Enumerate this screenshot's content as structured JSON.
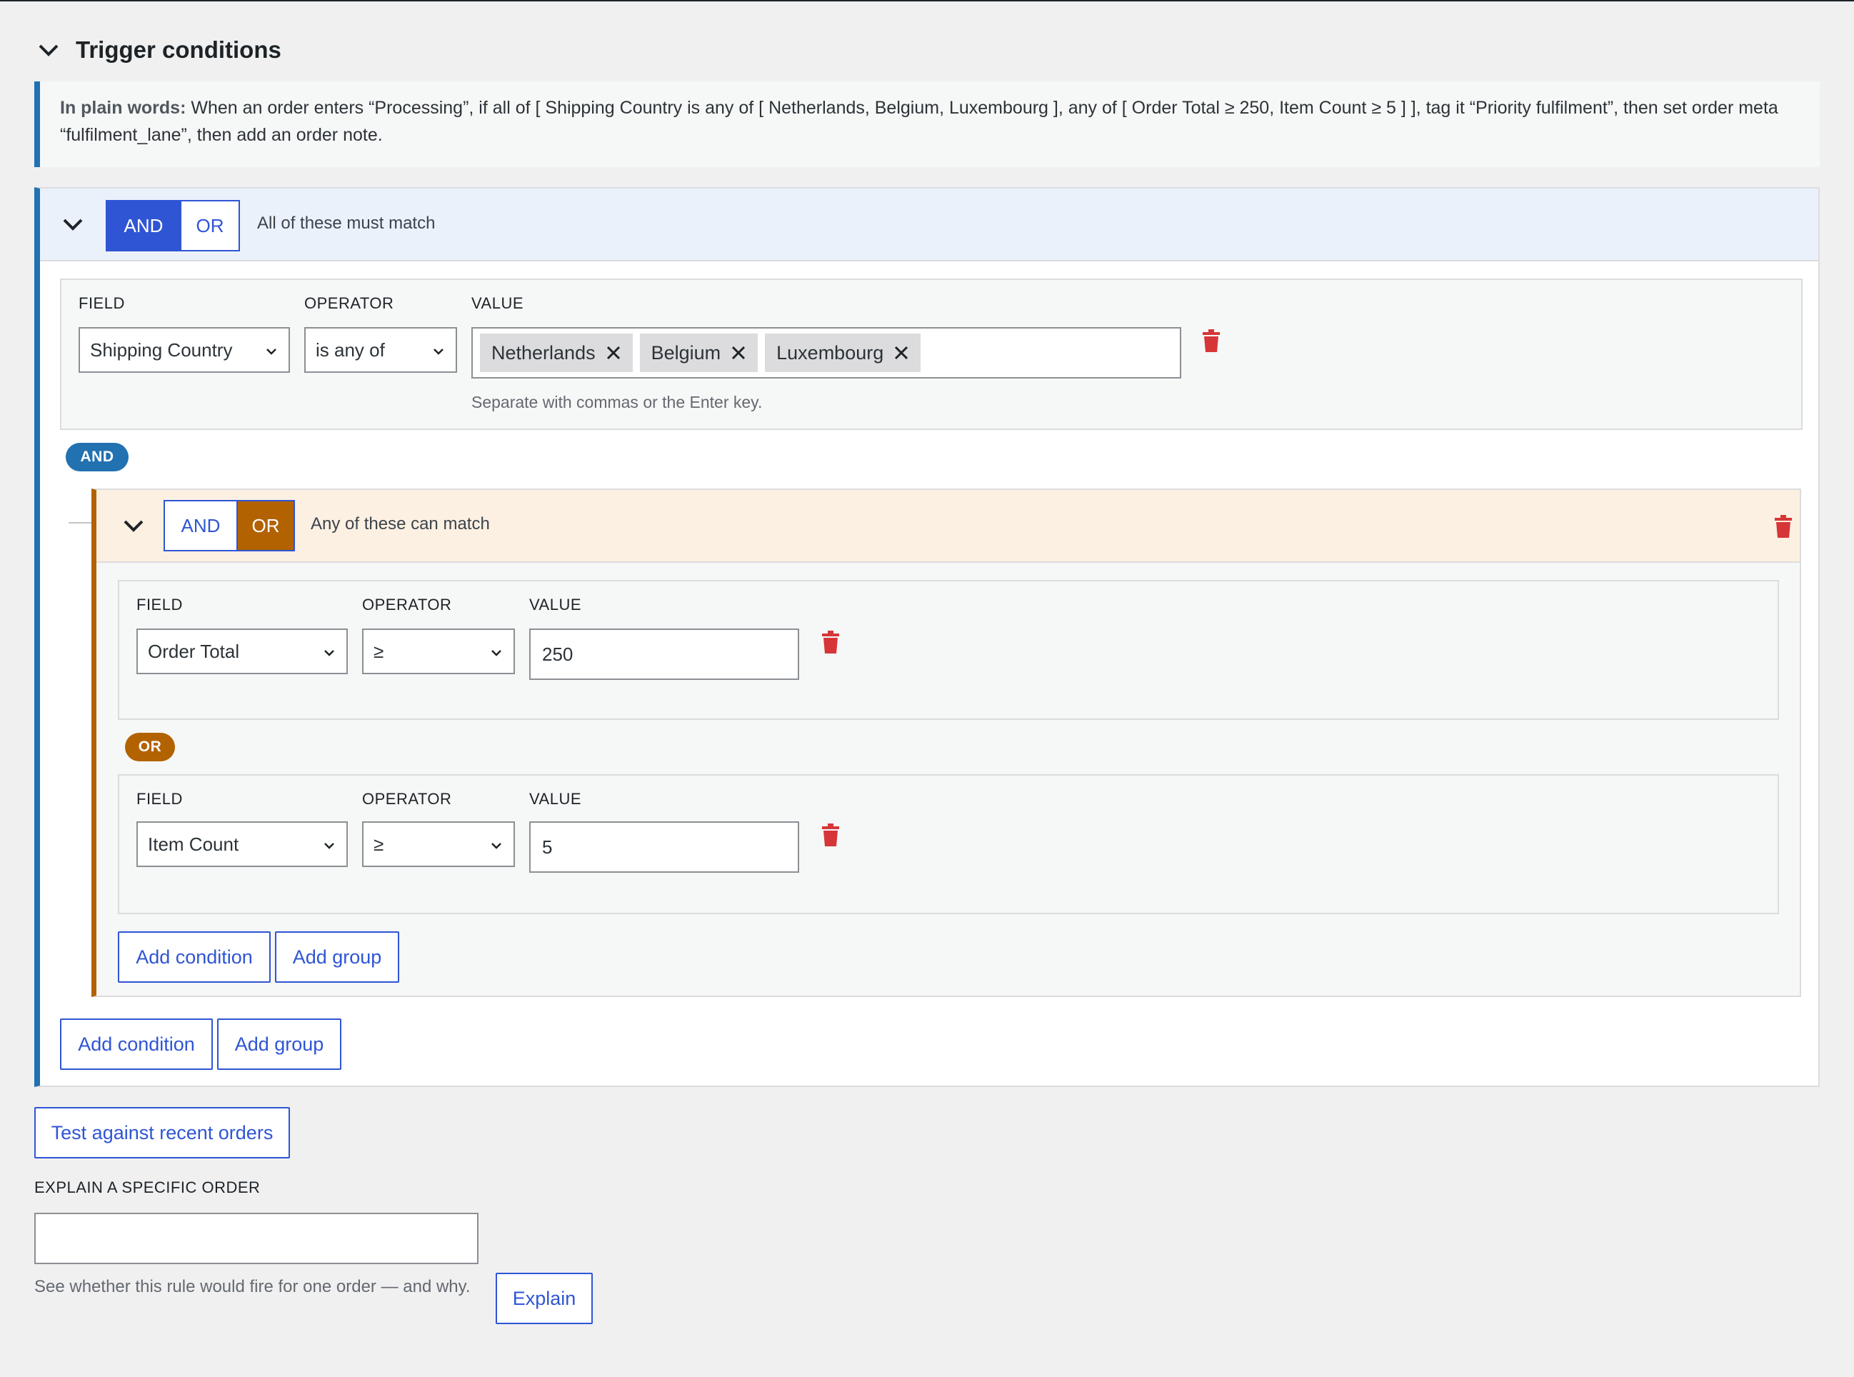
{
  "section": {
    "title": "Trigger conditions"
  },
  "notice": {
    "prefix": "In plain words:",
    "text": " When an order enters “Processing”, if all of [ Shipping Country is any of [ Netherlands, Belgium, Luxembourg ], any of [ Order Total ≥ 250, Item Count ≥ 5 ] ], tag it “Priority fulfilment”, then set order meta “fulfilment_lane”, then add an order note."
  },
  "root_group": {
    "and_label": "AND",
    "or_label": "OR",
    "active": "AND",
    "description": "All of these must match",
    "condition": {
      "field_label": "FIELD",
      "operator_label": "OPERATOR",
      "value_label": "VALUE",
      "field": "Shipping Country",
      "operator": "is any of",
      "tokens": [
        "Netherlands",
        "Belgium",
        "Luxembourg"
      ],
      "help": "Separate with commas or the Enter key."
    },
    "joiner": "AND",
    "add_condition": "Add condition",
    "add_group": "Add group"
  },
  "nested_group": {
    "and_label": "AND",
    "or_label": "OR",
    "active": "OR",
    "description": "Any of these can match",
    "conditions": [
      {
        "field_label": "FIELD",
        "operator_label": "OPERATOR",
        "value_label": "VALUE",
        "field": "Order Total",
        "operator": "≥",
        "value": "250"
      },
      {
        "field_label": "FIELD",
        "operator_label": "OPERATOR",
        "value_label": "VALUE",
        "field": "Item Count",
        "operator": "≥",
        "value": "5"
      }
    ],
    "joiner": "OR",
    "add_condition": "Add condition",
    "add_group": "Add group"
  },
  "test": {
    "button": "Test against recent orders"
  },
  "explain": {
    "label": "EXPLAIN A SPECIFIC ORDER",
    "input_value": "",
    "help": "See whether this rule would fire for one order — and why.",
    "button": "Explain"
  },
  "colors": {
    "blue_accent": "#2f55d4",
    "root_border": "#2271b1",
    "or_accent": "#b26200",
    "delete": "#d63638"
  },
  "icons": {
    "collapse": "chevron-down-icon",
    "delete": "trash-icon",
    "remove_token": "close-icon",
    "select_caret": "chevron-down-icon"
  }
}
